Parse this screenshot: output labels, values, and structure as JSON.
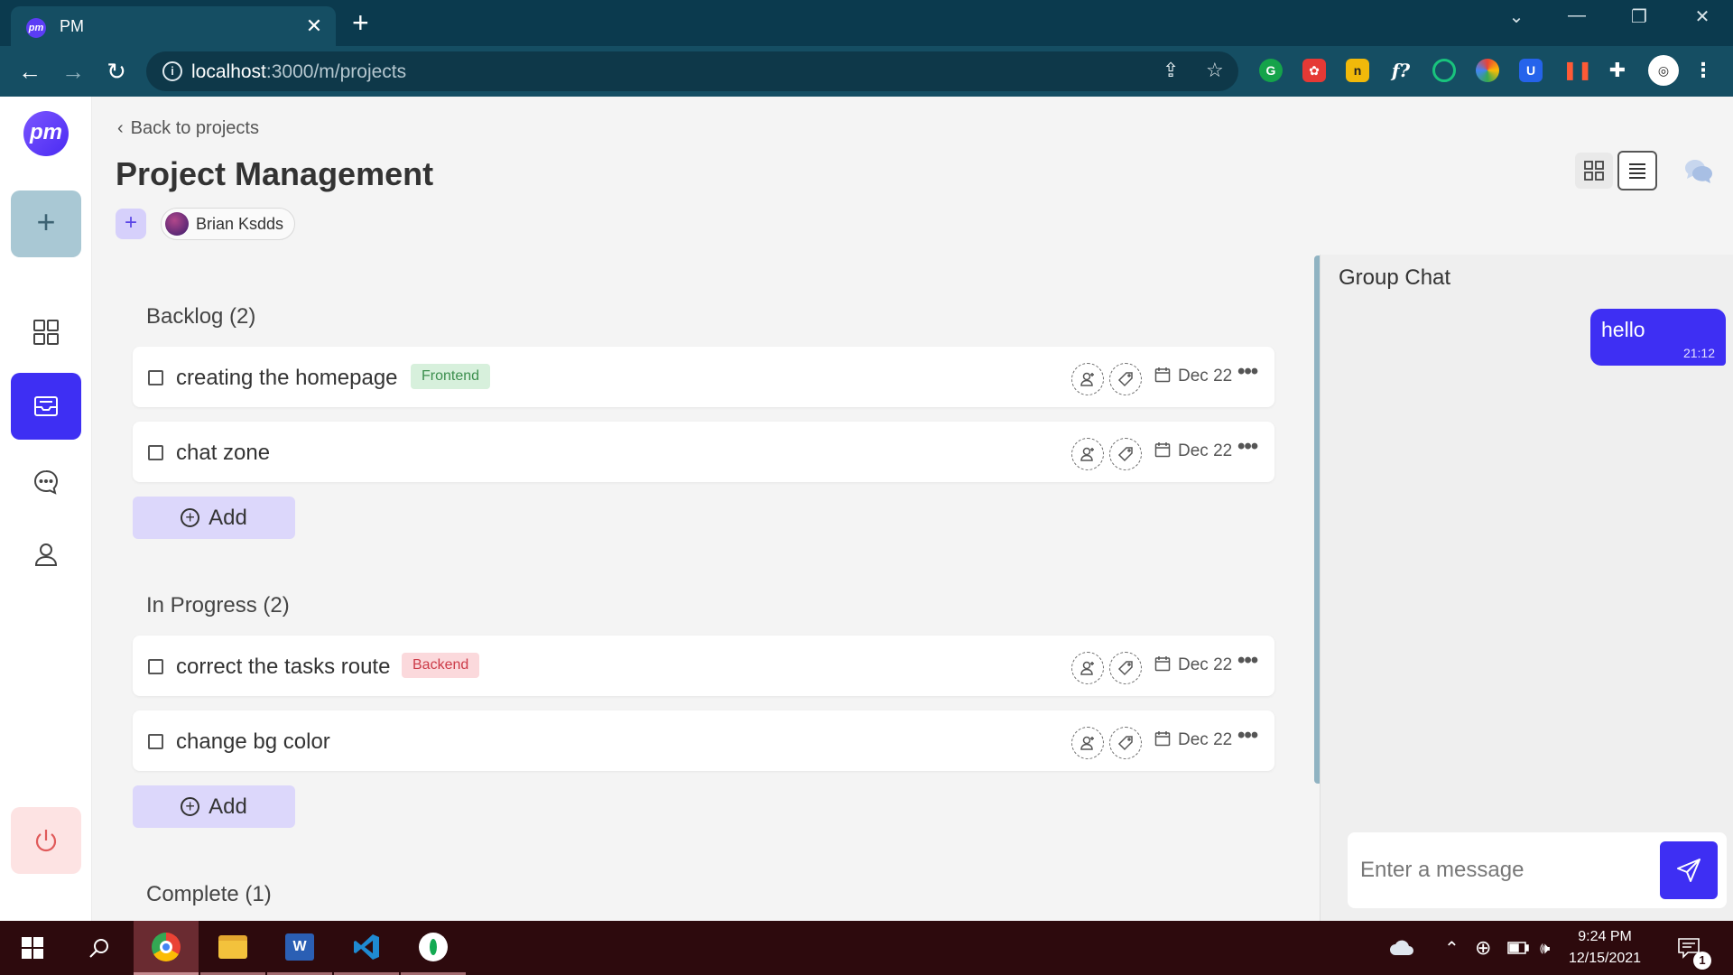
{
  "browser": {
    "tab_title": "PM",
    "tab_favicon": "pm",
    "tab_close": "✕",
    "new_tab": "+",
    "url_host": "localhost",
    "url_path": ":3000/m/projects",
    "window_controls": [
      "⌄",
      "—",
      "❐",
      "✕"
    ]
  },
  "sidebar": {
    "logo": "pm",
    "add_label": "+",
    "items": [
      {
        "name": "dashboard",
        "icon": "grid-icon"
      },
      {
        "name": "projects",
        "icon": "inbox-icon",
        "active": true
      },
      {
        "name": "chat",
        "icon": "chat-bubble-icon"
      },
      {
        "name": "profile",
        "icon": "user-icon"
      }
    ],
    "logout_icon": "power-icon"
  },
  "header": {
    "back_label": "Back to projects",
    "title": "Project Management",
    "add_member_label": "+",
    "members": [
      {
        "name": "Brian Ksdds"
      }
    ]
  },
  "sections": [
    {
      "title": "Backlog (2)",
      "tasks": [
        {
          "name": "creating the homepage",
          "tag": "Frontend",
          "date": "Dec 22"
        },
        {
          "name": "chat zone",
          "tag": "",
          "date": "Dec 22"
        }
      ],
      "add_label": "Add"
    },
    {
      "title": "In Progress (2)",
      "tasks": [
        {
          "name": "correct the tasks route",
          "tag": "Backend",
          "date": "Dec 22"
        },
        {
          "name": "change bg color",
          "tag": "",
          "date": "Dec 22"
        }
      ],
      "add_label": "Add"
    },
    {
      "title": "Complete (1)",
      "tasks": []
    }
  ],
  "more_label": "•••",
  "chat": {
    "title": "Group Chat",
    "messages": [
      {
        "text": "hello",
        "time": "21:12"
      }
    ],
    "input_placeholder": "Enter a message"
  },
  "taskbar": {
    "time": "9:24 PM",
    "date": "12/15/2021",
    "notification_count": "1",
    "apps": [
      "chrome-icon",
      "file-explorer-icon",
      "word-icon",
      "vscode-icon",
      "mongodb-compass-icon"
    ]
  },
  "colors": {
    "accent": "#3e2ff3",
    "chrome_dark": "#0b3a4e",
    "chrome_toolbar": "#154e63",
    "tag_frontend_bg": "#d7f0dc",
    "tag_backend_bg": "#fbd9dc",
    "taskbar": "#2d0a0d"
  }
}
